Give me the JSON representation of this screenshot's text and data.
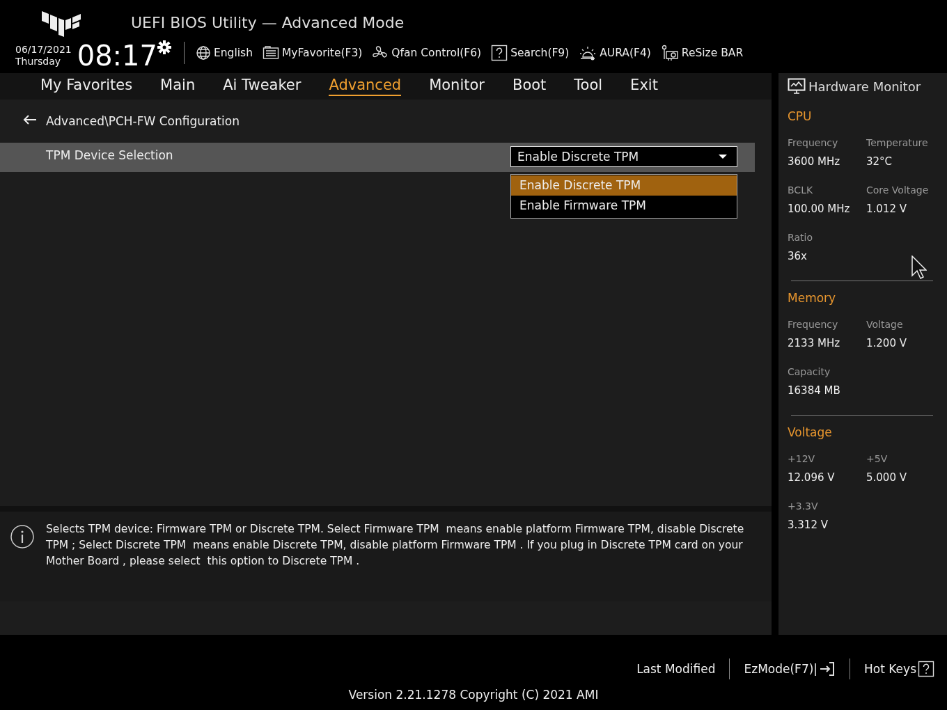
{
  "header": {
    "title": "UEFI BIOS Utility — Advanced Mode",
    "date": "06/17/2021",
    "day": "Thursday",
    "time": "08:17",
    "toolbar": [
      {
        "label": "English"
      },
      {
        "label": "MyFavorite(F3)"
      },
      {
        "label": "Qfan Control(F6)"
      },
      {
        "label": "Search(F9)"
      },
      {
        "label": "AURA(F4)"
      },
      {
        "label": "ReSize BAR"
      }
    ]
  },
  "tabs": [
    {
      "label": "My Favorites",
      "selected": false
    },
    {
      "label": "Main",
      "selected": false
    },
    {
      "label": "Ai Tweaker",
      "selected": false
    },
    {
      "label": "Advanced",
      "selected": true
    },
    {
      "label": "Monitor",
      "selected": false
    },
    {
      "label": "Boot",
      "selected": false
    },
    {
      "label": "Tool",
      "selected": false
    },
    {
      "label": "Exit",
      "selected": false
    }
  ],
  "breadcrumb": "Advanced\\PCH-FW Configuration",
  "settings": [
    {
      "label": "TPM Device Selection",
      "value": "Enable Discrete TPM",
      "selected": true,
      "expanded": true,
      "options": [
        {
          "label": "Enable Discrete TPM",
          "selected": true
        },
        {
          "label": "Enable Firmware TPM",
          "selected": false
        }
      ]
    }
  ],
  "help": "Selects TPM device: Firmware TPM or Discrete TPM. Select Firmware TPM  means enable platform Firmware TPM, disable Discrete TPM ; Select Discrete TPM  means enable Discrete TPM, disable platform Firmware TPM . If you plug in Discrete TPM card on your Mother Board , please select  this option to Discrete TPM .",
  "hardware_monitor": {
    "title": "Hardware Monitor",
    "sections": [
      {
        "title": "CPU",
        "items": [
          {
            "label": "Frequency",
            "value": "3600 MHz"
          },
          {
            "label": "Temperature",
            "value": "32°C"
          },
          {
            "label": "BCLK",
            "value": "100.00 MHz"
          },
          {
            "label": "Core Voltage",
            "value": "1.012 V"
          },
          {
            "label": "Ratio",
            "value": "36x"
          }
        ]
      },
      {
        "title": "Memory",
        "items": [
          {
            "label": "Frequency",
            "value": "2133 MHz"
          },
          {
            "label": "Voltage",
            "value": "1.200 V"
          },
          {
            "label": "Capacity",
            "value": "16384 MB"
          }
        ]
      },
      {
        "title": "Voltage",
        "items": [
          {
            "label": "+12V",
            "value": "12.096 V"
          },
          {
            "label": "+5V",
            "value": "5.000 V"
          },
          {
            "label": "+3.3V",
            "value": "3.312 V"
          }
        ]
      }
    ]
  },
  "footer": {
    "actions": [
      {
        "label": "Last Modified"
      },
      {
        "label": "EzMode(F7)|"
      },
      {
        "label": "Hot Keys"
      }
    ],
    "version": "Version 2.21.1278 Copyright (C) 2021 AMI"
  }
}
